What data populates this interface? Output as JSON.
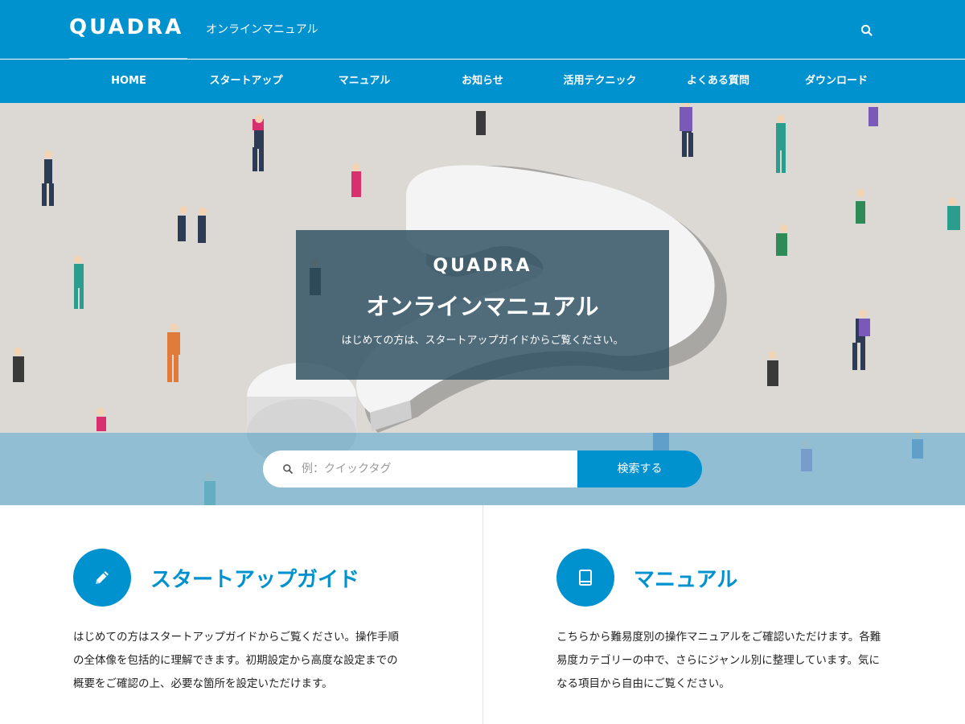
{
  "header": {
    "logo": "QUADRA",
    "subtitle": "オンラインマニュアル",
    "search_icon": "search-icon"
  },
  "nav": {
    "items": [
      {
        "label": "HOME"
      },
      {
        "label": "スタートアップ"
      },
      {
        "label": "マニュアル"
      },
      {
        "label": "お知らせ"
      },
      {
        "label": "活用テクニック"
      },
      {
        "label": "よくある質問"
      },
      {
        "label": "ダウンロード"
      }
    ]
  },
  "hero": {
    "brand": "QUADRA",
    "title": "オンラインマニュアル",
    "subtitle": "はじめての方は、スタートアップガイドからご覧ください。",
    "search": {
      "placeholder": "例：クイックタグ",
      "value": "",
      "button_label": "検索する"
    }
  },
  "cards": [
    {
      "icon": "pencil-icon",
      "title": "スタートアップガイド",
      "text": "はじめての方はスタートアップガイドからご覧ください。操作手順の全体像を包括的に理解できます。初期設定から高度な設定までの概要をご確認の上、必要な箇所を設定いただけます。"
    },
    {
      "icon": "book-icon",
      "title": "マニュアル",
      "text": "こちらから難易度別の操作マニュアルをご確認いただけます。各難易度カテゴリーの中で、さらにジャンル別に整理しています。気になる項目から自由にご覧ください。"
    }
  ],
  "colors": {
    "primary": "#0091cf",
    "hero_bg": "#dcd9d4",
    "overlay": "#2c4e60"
  }
}
